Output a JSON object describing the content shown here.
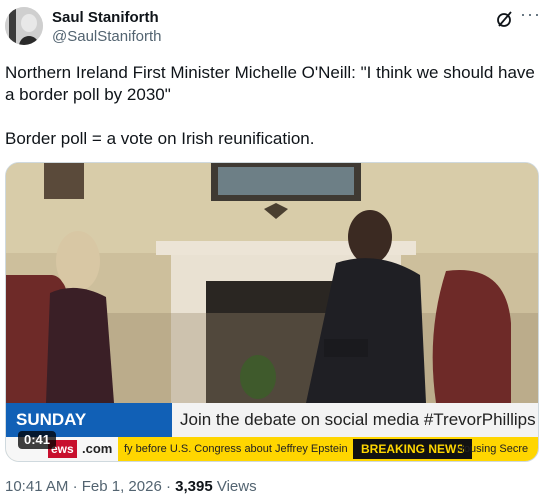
{
  "author": {
    "name": "Saul Staniforth",
    "handle": "@SaulStaniforth"
  },
  "tweet": {
    "text": "Northern Ireland First Minister Michelle O'Neill: \"I think we should have a border poll by 2030\"\n\nBorder poll = a vote on Irish reunification."
  },
  "video": {
    "duration": "0:41",
    "lower_third": {
      "program": "SUNDAY MORNING",
      "banner": "Join the debate on social media #TrevorPhillips",
      "brand_short": "ews",
      "brand_suffix": ".com",
      "ticker": "fy before U.S. Congress about Jeffrey Epstein",
      "breaking": "BREAKING NEWS",
      "ticker_next": "Housing Secre"
    }
  },
  "meta": {
    "time": "10:41 AM",
    "separator": "·",
    "date": "Feb 1, 2026",
    "views_count": "3,395",
    "views_label": "Views"
  },
  "icons": {
    "grok": "grok-icon",
    "more": "more-icon"
  },
  "colors": {
    "accent_blue": "#1160b6",
    "ticker_yellow": "#ffd600",
    "brand_red": "#c8102e",
    "secondary_text": "#536471"
  }
}
